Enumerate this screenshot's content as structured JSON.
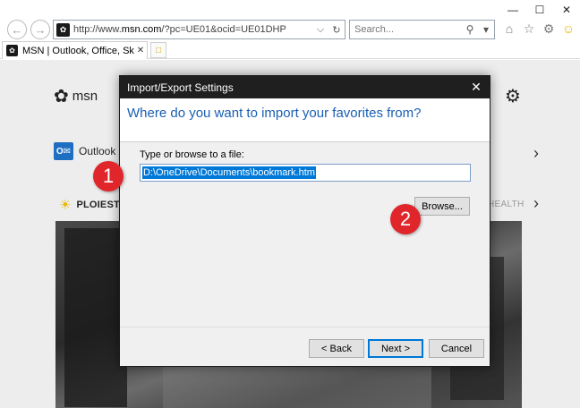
{
  "browser": {
    "url_prefix": "http://www.",
    "url_domain": "msn.com",
    "url_rest": "/?pc=UE01&ocid=UE01DHP",
    "search_placeholder": "Search...",
    "tab_label": "MSN | Outlook, Office, Sky...",
    "win_minimize": "—",
    "win_maximize": "☐",
    "win_close": "✕"
  },
  "page": {
    "logo_text": "msn",
    "nav_label": "Outlook",
    "weather_label": "PLOIEST",
    "health_label": "HEALTH"
  },
  "dialog": {
    "title": "Import/Export Settings",
    "heading": "Where do you want to import your favorites from?",
    "field_label": "Type or browse to a file:",
    "path_value": "D:\\OneDrive\\Documents\\bookmark.htm",
    "browse_label": "Browse...",
    "back_label": "< Back",
    "next_label": "Next >",
    "cancel_label": "Cancel",
    "close_glyph": "✕"
  },
  "markers": {
    "one": "1",
    "two": "2"
  },
  "colors": {
    "accent": "#0078d7",
    "heading": "#1a5fb4",
    "marker": "#e0262b",
    "titlebar": "#1f1f1f"
  }
}
